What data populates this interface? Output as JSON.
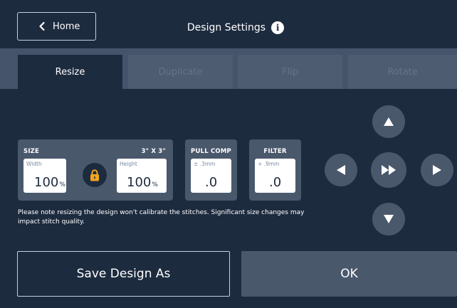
{
  "header": {
    "home_label": "Home",
    "title": "Design Settings",
    "info_glyph": "i"
  },
  "tabs": [
    {
      "label": "Resize",
      "active": true
    },
    {
      "label": "Duplicate",
      "active": false
    },
    {
      "label": "Flip",
      "active": false
    },
    {
      "label": "Rotate",
      "active": false
    }
  ],
  "size": {
    "label": "SIZE",
    "dimensions": "3\" X 3\"",
    "width": {
      "label": "Width",
      "value": "100",
      "unit": "%"
    },
    "height": {
      "label": "Height",
      "value": "100",
      "unit": "%"
    }
  },
  "pull_comp": {
    "label": "PULL COMP",
    "range": "± .3mm",
    "value": ".0"
  },
  "filter": {
    "label": "FILTER",
    "range": "+ .9mm",
    "value": ".0"
  },
  "note": "Please note resizing the design won't calibrate the stitches. Significant size changes may impact stitch quality.",
  "buttons": {
    "save_label": "Save Design As",
    "ok_label": "OK"
  },
  "colors": {
    "background": "#1d2b3f",
    "panel": "#4a586c",
    "lock_accent": "#f5a51c"
  }
}
